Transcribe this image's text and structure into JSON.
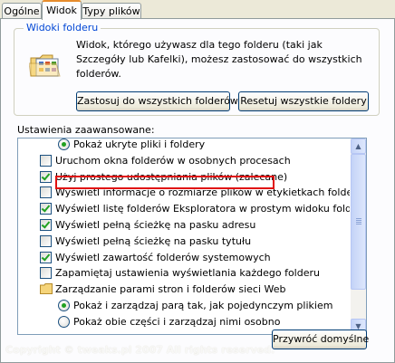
{
  "tabs": [
    "Ogólne",
    "Widok",
    "Typy plików"
  ],
  "folder_views": {
    "title": "Widoki folderu",
    "description": "Widok, którego używasz dla tego folderu (taki jak Szczegóły lub Kafelki), możesz zastosować do wszystkich folderów.",
    "apply_all_label": "Zastosuj do wszystkich folderów",
    "reset_all_label": "Resetuj wszystkie foldery"
  },
  "advanced": {
    "label": "Ustawienia zaawansowane:",
    "items": [
      {
        "type": "radio",
        "checked": true,
        "indent": 1,
        "label": "Pokaż ukryte pliki i foldery"
      },
      {
        "type": "checkbox",
        "checked": false,
        "indent": 0,
        "label": "Uruchom okna folderów w osobnych procesach",
        "highlighted": true
      },
      {
        "type": "checkbox",
        "checked": true,
        "indent": 0,
        "label": "Użyj prostego udostępniania plików (zalecane)"
      },
      {
        "type": "checkbox",
        "checked": false,
        "indent": 0,
        "label": "Wyświetl informacje o rozmiarze plików w etykietkach folderów"
      },
      {
        "type": "checkbox",
        "checked": true,
        "indent": 0,
        "label": "Wyświetl listę folderów Eksploratora w prostym widoku folderów"
      },
      {
        "type": "checkbox",
        "checked": true,
        "indent": 0,
        "label": "Wyświetl pełną ścieżkę na pasku adresu"
      },
      {
        "type": "checkbox",
        "checked": false,
        "indent": 0,
        "label": "Wyświetl pełną ścieżkę na pasku tytułu"
      },
      {
        "type": "checkbox",
        "checked": true,
        "indent": 0,
        "label": "Wyświetl zawartość folderów systemowych"
      },
      {
        "type": "checkbox",
        "checked": false,
        "indent": 0,
        "label": "Zapamiętaj ustawienia wyświetlania każdego folderu"
      },
      {
        "type": "folder",
        "checked": false,
        "indent": 0,
        "label": "Zarządzanie parami stron i folderów sieci Web"
      },
      {
        "type": "radio",
        "checked": true,
        "indent": 1,
        "label": "Pokaż i zarządzaj parą tak, jak pojedynczym plikiem"
      },
      {
        "type": "radio",
        "checked": false,
        "indent": 1,
        "label": "Pokaż obie części i zarządzaj nimi osobno"
      }
    ]
  },
  "restore_defaults_label": "Przywróć domyślne",
  "watermark": "Copyright © tweaks.pl 2007 All rights reserved."
}
